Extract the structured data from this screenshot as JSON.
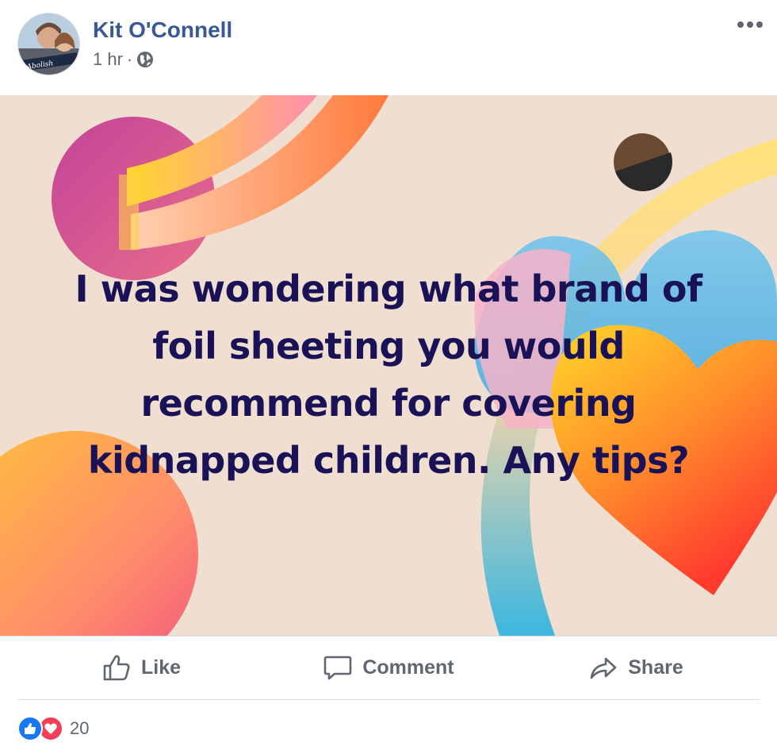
{
  "post": {
    "author": "Kit O'Connell",
    "time": "1 hr",
    "separator": "·",
    "privacy_icon": "globe-icon",
    "body_lines": [
      "I was wondering what brand of",
      "foil sheeting you would",
      "recommend for covering",
      "kidnapped children. Any tips?"
    ]
  },
  "actions": {
    "like": "Like",
    "comment": "Comment",
    "share": "Share"
  },
  "reactions": {
    "count": "20",
    "icons": [
      "like-icon",
      "love-icon"
    ]
  },
  "colors": {
    "author": "#385898",
    "post_text": "#1a1256",
    "background": "#f0dfd0",
    "like": "#1877f2",
    "love": "#f33e58"
  }
}
